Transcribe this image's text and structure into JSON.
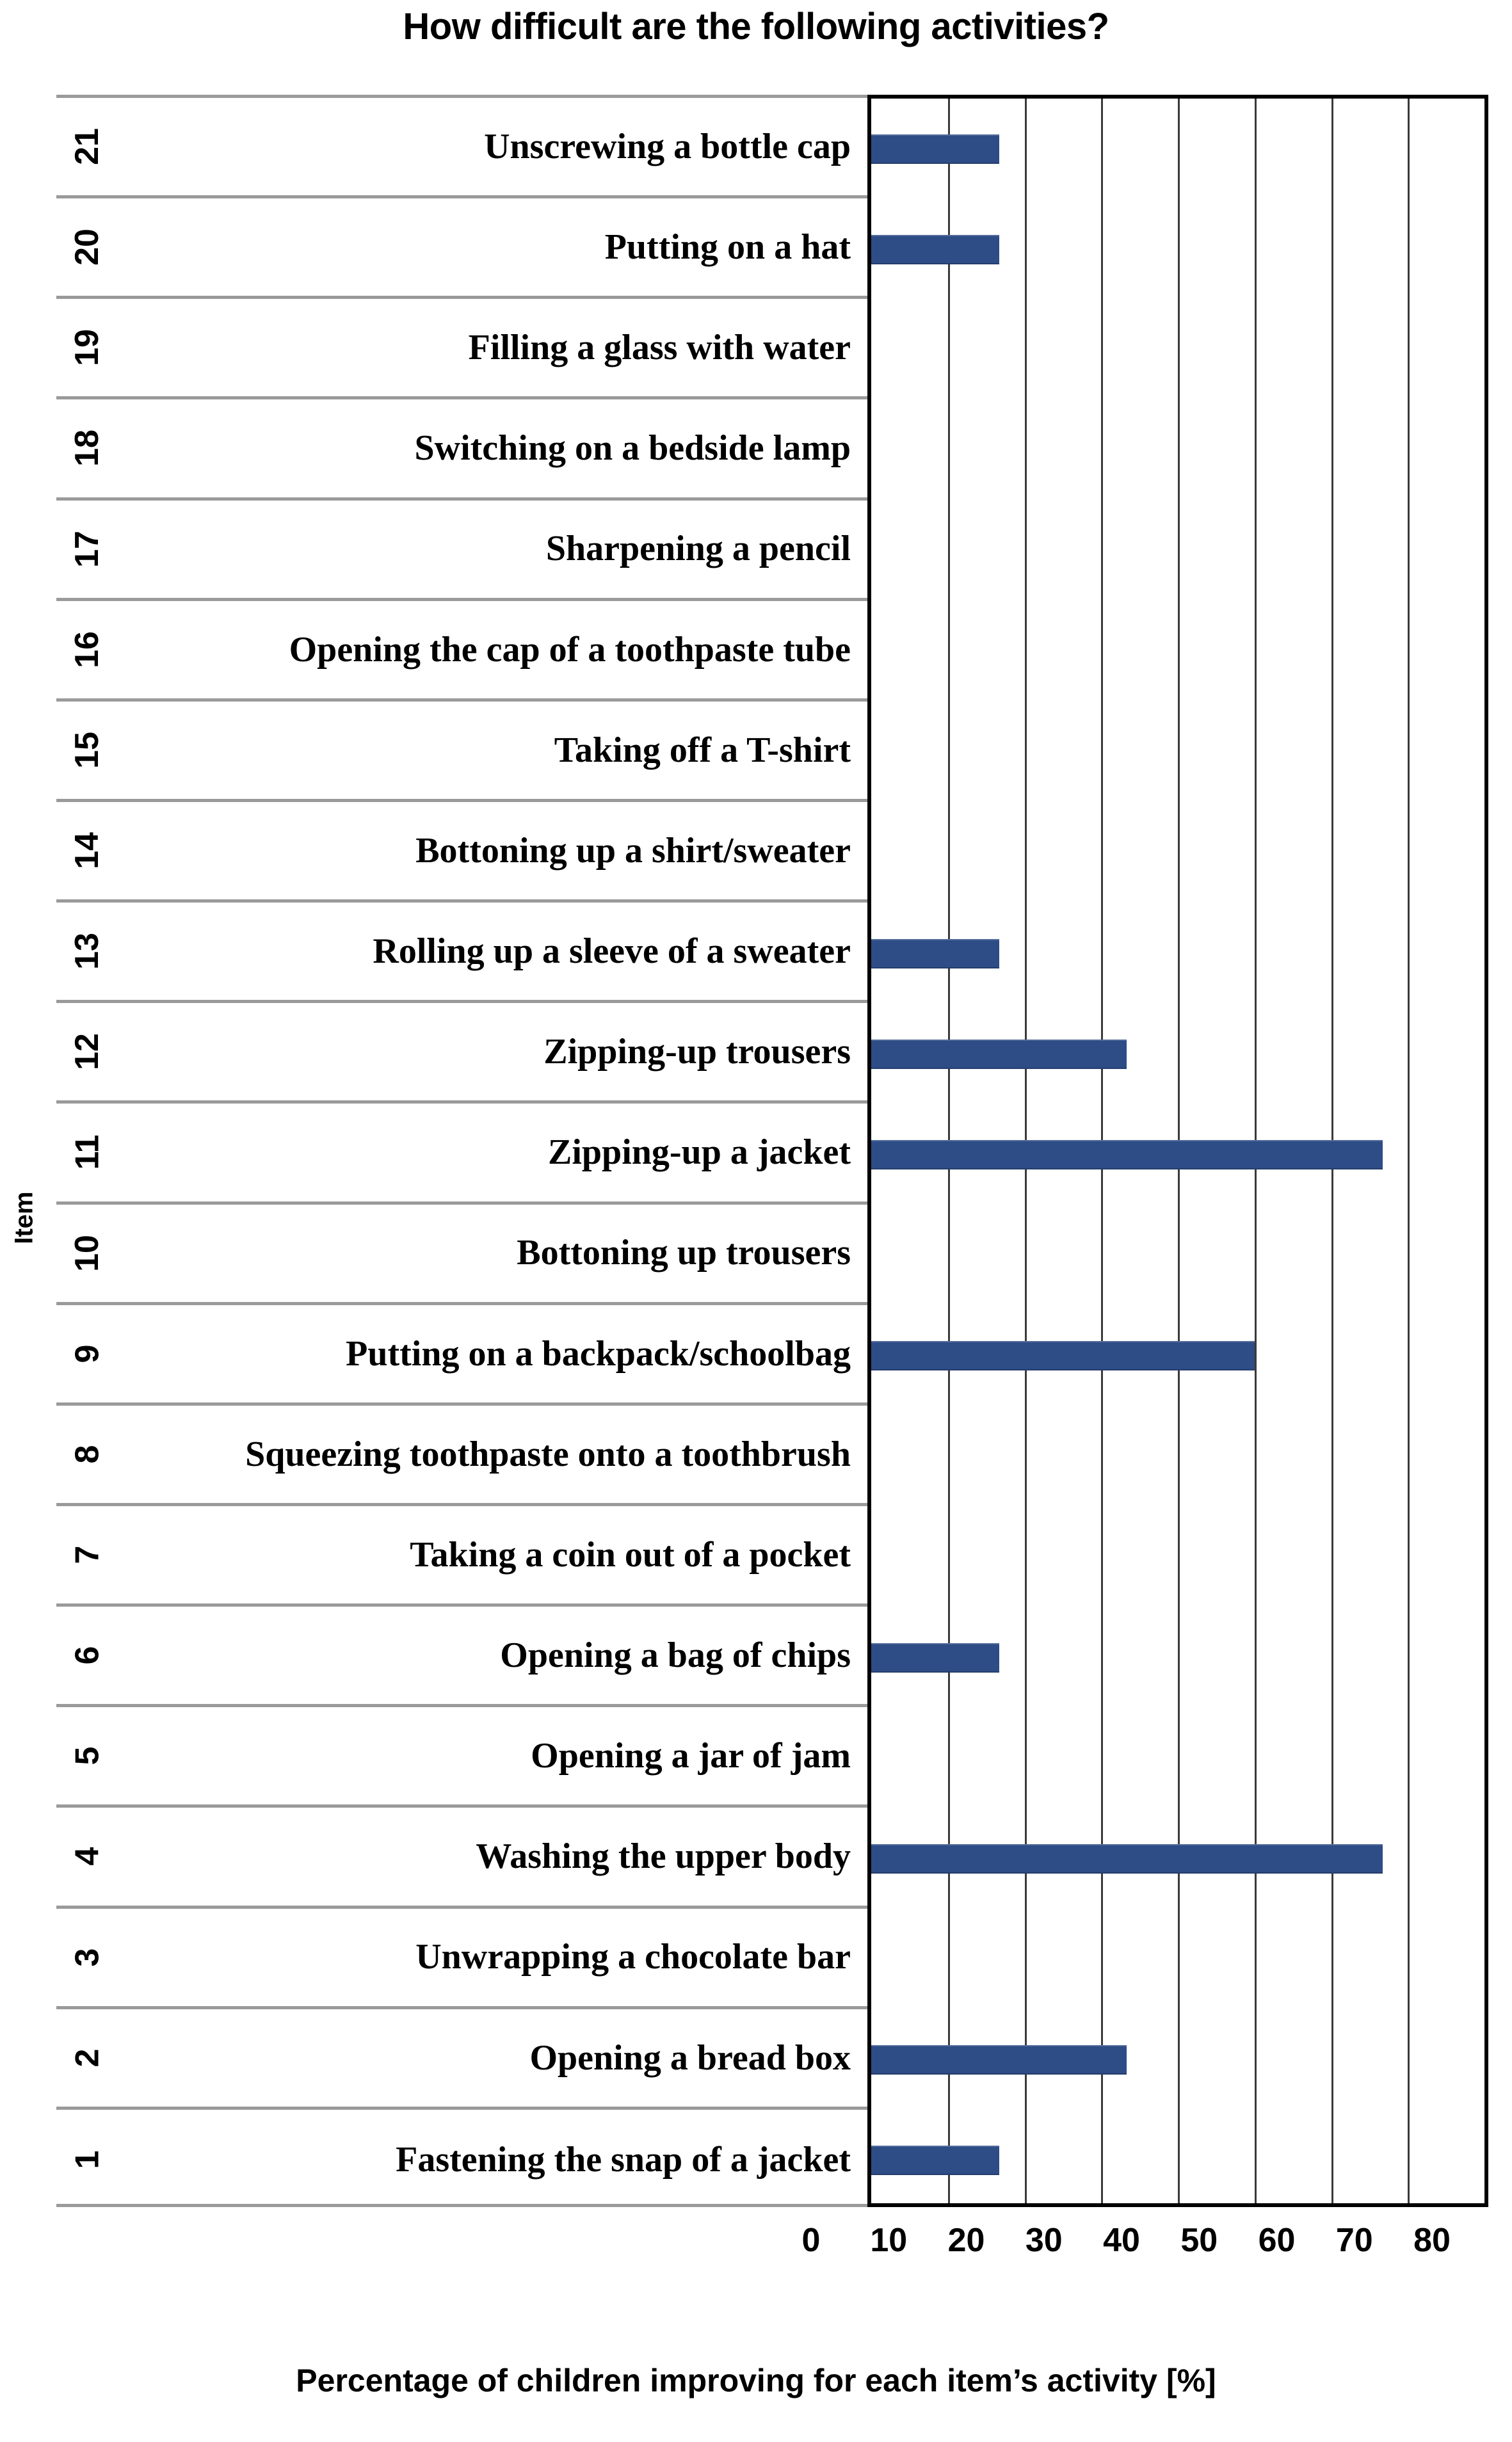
{
  "chart_data": {
    "type": "bar",
    "orientation": "horizontal",
    "title": "How difficult are the following activities?",
    "xlabel": "Percentage of children improving for each item’s activity [%]",
    "ylabel": "Item",
    "xlim": [
      0,
      80
    ],
    "xticks": [
      "0",
      "10",
      "20",
      "30",
      "40",
      "50",
      "60",
      "70",
      "80"
    ],
    "grid": "vertical",
    "legend": "none",
    "bar_color": "#2e4c86",
    "categories": [
      "Unscrewing a bottle cap",
      "Putting on a hat",
      "Filling a glass with water",
      "Switching on a bedside lamp",
      "Sharpening a pencil",
      "Opening the cap of a toothpaste tube",
      "Taking off a T-shirt",
      "Bottoning up a shirt/sweater",
      "Rolling up a sleeve of a sweater",
      "Zipping-up trousers",
      "Zipping-up a jacket",
      "Bottoning up trousers",
      "Putting on a backpack/schoolbag",
      "Squeezing toothpaste onto a toothbrush",
      "Taking a coin out of a pocket",
      "Opening a bag of chips",
      "Opening a jar of jam",
      "Washing the upper body",
      "Unwrapping a chocolate bar",
      "Opening a bread box",
      "Fastening the snap of a jacket"
    ],
    "item_numbers": [
      21,
      20,
      19,
      18,
      17,
      16,
      15,
      14,
      13,
      12,
      11,
      10,
      9,
      8,
      7,
      6,
      5,
      4,
      3,
      2,
      1
    ],
    "values": [
      16.7,
      16.7,
      0,
      0,
      0,
      0,
      0,
      0,
      16.7,
      33.3,
      66.7,
      0,
      50.0,
      0,
      0,
      16.7,
      0,
      66.7,
      0,
      33.3,
      16.7
    ]
  },
  "rows": [
    {
      "num": "21",
      "label": "Unscrewing a bottle cap",
      "value": 16.7
    },
    {
      "num": "20",
      "label": "Putting on a hat",
      "value": 16.7
    },
    {
      "num": "19",
      "label": "Filling a glass with water",
      "value": 0
    },
    {
      "num": "18",
      "label": "Switching on a bedside lamp",
      "value": 0
    },
    {
      "num": "17",
      "label": "Sharpening a pencil",
      "value": 0
    },
    {
      "num": "16",
      "label": "Opening the cap of a toothpaste tube",
      "value": 0
    },
    {
      "num": "15",
      "label": "Taking off a T-shirt",
      "value": 0
    },
    {
      "num": "14",
      "label": "Bottoning up a shirt/sweater",
      "value": 0
    },
    {
      "num": "13",
      "label": "Rolling up a sleeve of a sweater",
      "value": 16.7
    },
    {
      "num": "12",
      "label": "Zipping-up trousers",
      "value": 33.3
    },
    {
      "num": "11",
      "label": "Zipping-up a jacket",
      "value": 66.7
    },
    {
      "num": "10",
      "label": "Bottoning up trousers",
      "value": 0
    },
    {
      "num": "9",
      "label": "Putting on a backpack/schoolbag",
      "value": 50.0
    },
    {
      "num": "8",
      "label": "Squeezing toothpaste onto a toothbrush",
      "value": 0
    },
    {
      "num": "7",
      "label": "Taking a coin out of a pocket",
      "value": 0
    },
    {
      "num": "6",
      "label": "Opening a bag of chips",
      "value": 16.7
    },
    {
      "num": "5",
      "label": "Opening a jar of jam",
      "value": 0
    },
    {
      "num": "4",
      "label": "Washing the upper body",
      "value": 66.7
    },
    {
      "num": "3",
      "label": "Unwrapping a chocolate bar",
      "value": 0
    },
    {
      "num": "2",
      "label": "Opening a bread box",
      "value": 33.3
    },
    {
      "num": "1",
      "label": "Fastening the snap of a jacket",
      "value": 16.7
    }
  ],
  "title": "How difficult are the following activities?",
  "y_axis_title": "Item",
  "x_axis_title": "Percentage of children improving for each item’s activity [%]",
  "x_tick_labels": [
    "0",
    "10",
    "20",
    "30",
    "40",
    "50",
    "60",
    "70",
    "80"
  ]
}
